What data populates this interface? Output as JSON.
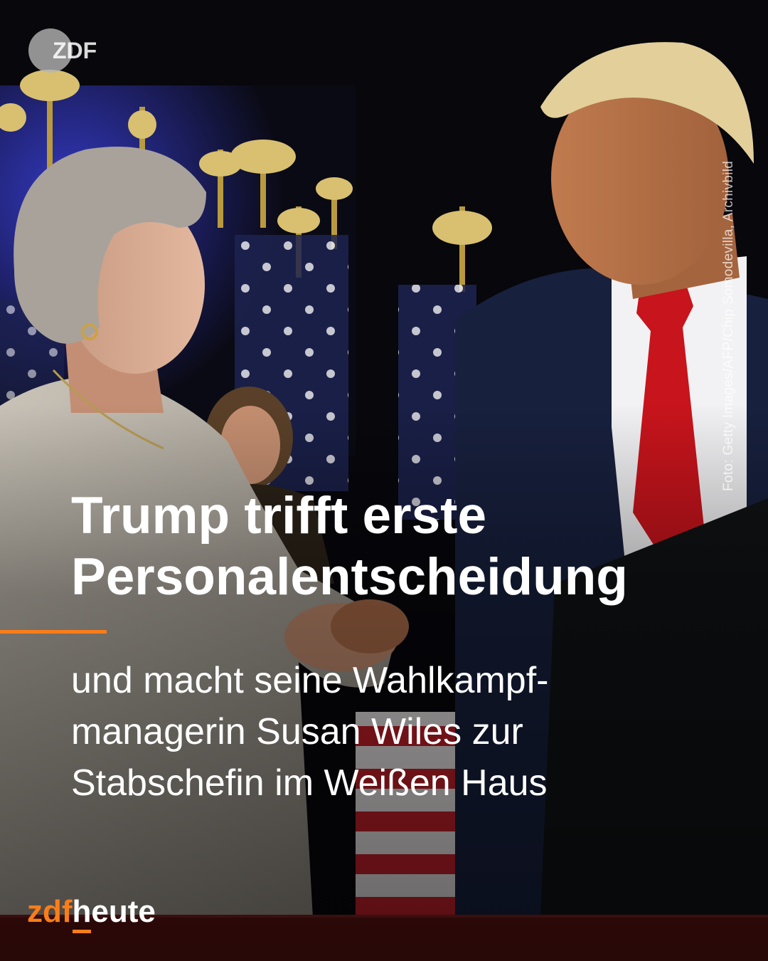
{
  "header": {
    "logo_text": "ZDF",
    "photo_credit": "Foto: Getty Images/AFP/Chip Somodevilla, Archivbild"
  },
  "headline": {
    "line1": "Trump trifft erste",
    "line2": "Personalentscheidung"
  },
  "subline": {
    "line1": "und macht seine Wahlkampf-",
    "line2": "managerin Susan Wiles zur",
    "line3": "Stabschefin im Weißen Haus"
  },
  "brand": {
    "part1": "zdf",
    "part2": "heute"
  },
  "colors": {
    "accent": "#fa7d19",
    "text": "#ffffff",
    "tie": "#c8141c",
    "suit": "#17203d",
    "stage_light": "#2a2fa8"
  }
}
